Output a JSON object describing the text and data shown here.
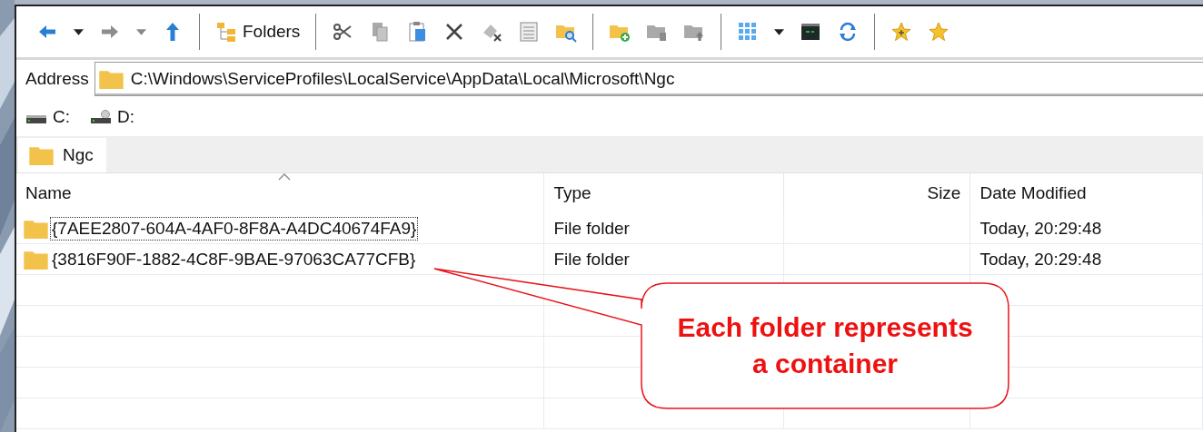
{
  "toolbar": {
    "back": {
      "disabled": false
    },
    "forward": {
      "disabled": true
    },
    "folders_label": "Folders"
  },
  "address": {
    "label": "Address",
    "value": "C:\\Windows\\ServiceProfiles\\LocalService\\AppData\\Local\\Microsoft\\Ngc"
  },
  "drives": [
    {
      "label": "C:",
      "kind": "disk"
    },
    {
      "label": "D:",
      "kind": "optical"
    }
  ],
  "tabs": [
    {
      "label": "Ngc",
      "selected": true
    }
  ],
  "table": {
    "columns": [
      {
        "label": "Name",
        "sorted": true
      },
      {
        "label": "Type",
        "sorted": false
      },
      {
        "label": "Size",
        "sorted": false
      },
      {
        "label": "Date Modified",
        "sorted": false
      }
    ],
    "rows": [
      {
        "name": "{7AEE2807-604A-4AF0-8F8A-A4DC40674FA9}",
        "type": "File folder",
        "date_modified": "Today, 20:29:48",
        "focused": true
      },
      {
        "name": "{3816F90F-1882-4C8F-9BAE-97063CA77CFB}",
        "type": "File folder",
        "date_modified": "Today, 20:29:48",
        "focused": false
      }
    ]
  },
  "callout": {
    "text": "Each folder represents a container"
  }
}
